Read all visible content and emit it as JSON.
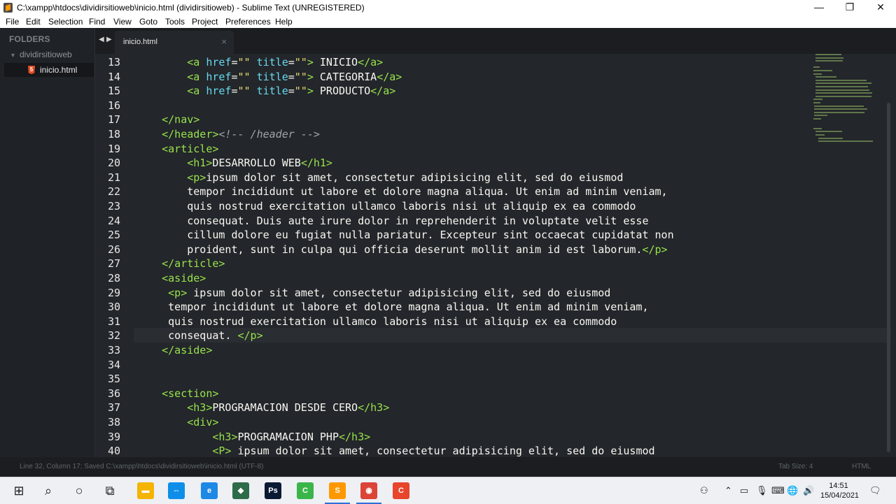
{
  "window": {
    "title": "C:\\xampp\\htdocs\\dividirsitioweb\\inicio.html (dividirsitioweb) - Sublime Text (UNREGISTERED)",
    "minimize": "—",
    "maximize": "❐",
    "close": "✕"
  },
  "menu": [
    "File",
    "Edit",
    "Selection",
    "Find",
    "View",
    "Goto",
    "Tools",
    "Project",
    "Preferences",
    "Help"
  ],
  "sidebar": {
    "header": "FOLDERS",
    "folder": "dividirsitioweb",
    "folder_chevron": "▼",
    "file": "inicio.html",
    "file_icon": "5"
  },
  "tabs": {
    "prev": "◀",
    "next": "▶",
    "active": "inicio.html",
    "close": "×"
  },
  "editor": {
    "lines": [
      {
        "n": "13",
        "indent": "        ",
        "tokens": [
          [
            "tag",
            "<a "
          ],
          [
            "attr",
            "href"
          ],
          [
            "punc",
            "="
          ],
          [
            "str",
            "\"\""
          ],
          [
            "punc",
            " "
          ],
          [
            "attr",
            "title"
          ],
          [
            "punc",
            "="
          ],
          [
            "str",
            "\"\""
          ],
          [
            "tag",
            ">"
          ],
          [
            "text",
            " INICIO"
          ],
          [
            "tag",
            "</a>"
          ]
        ]
      },
      {
        "n": "14",
        "indent": "        ",
        "tokens": [
          [
            "tag",
            "<a "
          ],
          [
            "attr",
            "href"
          ],
          [
            "punc",
            "="
          ],
          [
            "str",
            "\"\""
          ],
          [
            "punc",
            " "
          ],
          [
            "attr",
            "title"
          ],
          [
            "punc",
            "="
          ],
          [
            "str",
            "\"\""
          ],
          [
            "tag",
            ">"
          ],
          [
            "text",
            " CATEGORIA"
          ],
          [
            "tag",
            "</a>"
          ]
        ]
      },
      {
        "n": "15",
        "indent": "        ",
        "tokens": [
          [
            "tag",
            "<a "
          ],
          [
            "attr",
            "href"
          ],
          [
            "punc",
            "="
          ],
          [
            "str",
            "\"\""
          ],
          [
            "punc",
            " "
          ],
          [
            "attr",
            "title"
          ],
          [
            "punc",
            "="
          ],
          [
            "str",
            "\"\""
          ],
          [
            "tag",
            ">"
          ],
          [
            "text",
            " PRODUCTO"
          ],
          [
            "tag",
            "</a>"
          ]
        ]
      },
      {
        "n": "16",
        "indent": "",
        "tokens": []
      },
      {
        "n": "17",
        "indent": "    ",
        "tokens": [
          [
            "tag",
            "</nav>"
          ]
        ]
      },
      {
        "n": "18",
        "indent": "    ",
        "tokens": [
          [
            "tag",
            "</header>"
          ],
          [
            "comment",
            "<!-- /header -->"
          ]
        ]
      },
      {
        "n": "19",
        "indent": "    ",
        "tokens": [
          [
            "tag",
            "<article>"
          ]
        ]
      },
      {
        "n": "20",
        "indent": "        ",
        "tokens": [
          [
            "tag",
            "<h1>"
          ],
          [
            "text",
            "DESARROLLO WEB"
          ],
          [
            "tag",
            "</h1>"
          ]
        ]
      },
      {
        "n": "21",
        "indent": "        ",
        "tokens": [
          [
            "tag",
            "<p>"
          ],
          [
            "text",
            "ipsum dolor sit amet, consectetur adipisicing elit, sed do eiusmod"
          ]
        ]
      },
      {
        "n": "22",
        "indent": "        ",
        "tokens": [
          [
            "text",
            "tempor incididunt ut labore et dolore magna aliqua. Ut enim ad minim veniam,"
          ]
        ]
      },
      {
        "n": "23",
        "indent": "        ",
        "tokens": [
          [
            "text",
            "quis nostrud exercitation ullamco laboris nisi ut aliquip ex ea commodo"
          ]
        ]
      },
      {
        "n": "24",
        "indent": "        ",
        "tokens": [
          [
            "text",
            "consequat. Duis aute irure dolor in reprehenderit in voluptate velit esse"
          ]
        ]
      },
      {
        "n": "25",
        "indent": "        ",
        "tokens": [
          [
            "text",
            "cillum dolore eu fugiat nulla pariatur. Excepteur sint occaecat cupidatat non"
          ]
        ]
      },
      {
        "n": "26",
        "indent": "        ",
        "tokens": [
          [
            "text",
            "proident, sunt in culpa qui officia deserunt mollit anim id est laborum."
          ],
          [
            "tag",
            "</p>"
          ]
        ]
      },
      {
        "n": "27",
        "indent": "    ",
        "tokens": [
          [
            "tag",
            "</article>"
          ]
        ]
      },
      {
        "n": "28",
        "indent": "    ",
        "tokens": [
          [
            "tag",
            "<aside>"
          ]
        ]
      },
      {
        "n": "29",
        "indent": "     ",
        "tokens": [
          [
            "tag",
            "<p>"
          ],
          [
            "text",
            " ipsum dolor sit amet, consectetur adipisicing elit, sed do eiusmod"
          ]
        ]
      },
      {
        "n": "30",
        "indent": "     ",
        "tokens": [
          [
            "text",
            "tempor incididunt ut labore et dolore magna aliqua. Ut enim ad minim veniam,"
          ]
        ]
      },
      {
        "n": "31",
        "indent": "     ",
        "tokens": [
          [
            "text",
            "quis nostrud exercitation ullamco laboris nisi ut aliquip ex ea commodo"
          ]
        ]
      },
      {
        "n": "32",
        "indent": "     ",
        "tokens": [
          [
            "text",
            "consequat. "
          ],
          [
            "tag",
            "</p>"
          ]
        ]
      },
      {
        "n": "33",
        "indent": "    ",
        "tokens": [
          [
            "tag",
            "</aside>"
          ]
        ]
      },
      {
        "n": "34",
        "indent": "",
        "tokens": []
      },
      {
        "n": "35",
        "indent": "",
        "tokens": []
      },
      {
        "n": "36",
        "indent": "    ",
        "tokens": [
          [
            "tag",
            "<section>"
          ]
        ]
      },
      {
        "n": "37",
        "indent": "        ",
        "tokens": [
          [
            "tag",
            "<h3>"
          ],
          [
            "text",
            "PROGRAMACION DESDE CERO"
          ],
          [
            "tag",
            "</h3>"
          ]
        ]
      },
      {
        "n": "38",
        "indent": "        ",
        "tokens": [
          [
            "tag",
            "<div>"
          ]
        ]
      },
      {
        "n": "39",
        "indent": "            ",
        "tokens": [
          [
            "tag",
            "<h3>"
          ],
          [
            "text",
            "PROGRAMACION PHP"
          ],
          [
            "tag",
            "</h3>"
          ]
        ]
      },
      {
        "n": "40",
        "indent": "            ",
        "tokens": [
          [
            "tag",
            "<P>"
          ],
          [
            "text",
            " ipsum dolor sit amet, consectetur adipisicing elit, sed do eiusmod"
          ]
        ]
      }
    ],
    "active_line": "32"
  },
  "statusbar": {
    "left": "Line 32, Column 17; Saved C:\\xampp\\htdocs\\dividirsitioweb\\inicio.html (UTF-8)",
    "tab_size": "Tab Size: 4",
    "syntax": "HTML"
  },
  "taskbar": {
    "time": "14:51",
    "date": "15/04/2021",
    "apps": [
      {
        "name": "windows-start-icon",
        "glyph": "⊞",
        "color": "#1f1f1f"
      },
      {
        "name": "search-icon",
        "glyph": "⌕",
        "color": "#1f1f1f"
      },
      {
        "name": "cortana-icon",
        "glyph": "○",
        "color": "#1f1f1f"
      },
      {
        "name": "task-view-icon",
        "glyph": "⧉",
        "color": "#1f1f1f"
      },
      {
        "name": "file-explorer-icon",
        "glyph": "▬",
        "color": "#f4b400"
      },
      {
        "name": "teamviewer-icon",
        "glyph": "⇔",
        "color": "#0e8ee9"
      },
      {
        "name": "edge-icon",
        "glyph": "e",
        "color": "#1e88e5"
      },
      {
        "name": "app-green-icon",
        "glyph": "◆",
        "color": "#2e6b4a"
      },
      {
        "name": "photoshop-icon",
        "glyph": "Ps",
        "color": "#0a1a33"
      },
      {
        "name": "camtasia-icon",
        "glyph": "C",
        "color": "#3bb54a"
      },
      {
        "name": "sublime-text-icon",
        "glyph": "S",
        "color": "#ff9800"
      },
      {
        "name": "chrome-icon",
        "glyph": "◉",
        "color": "#db4437"
      },
      {
        "name": "camtasia-red-icon",
        "glyph": "C",
        "color": "#e8452c"
      }
    ],
    "tray": [
      {
        "name": "people-icon",
        "glyph": "⚇"
      },
      {
        "name": "chevron-up-icon",
        "glyph": "⌃"
      },
      {
        "name": "battery-icon",
        "glyph": "▭"
      },
      {
        "name": "microphone-icon",
        "glyph": "🎙"
      },
      {
        "name": "keyboard-icon",
        "glyph": "⌨"
      },
      {
        "name": "language-icon",
        "glyph": "🌐"
      },
      {
        "name": "volume-icon",
        "glyph": "🔊"
      }
    ],
    "notification_glyph": "🗨"
  }
}
